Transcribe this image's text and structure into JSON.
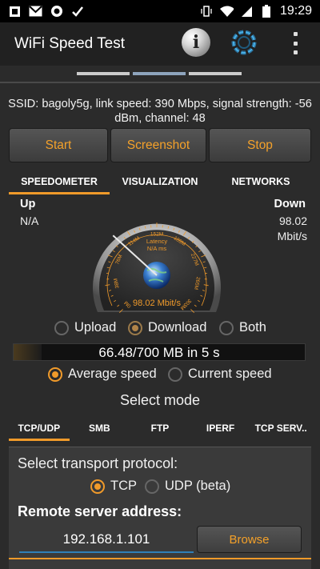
{
  "status_bar": {
    "time": "19:29",
    "icons_left": [
      "notification-app-icon",
      "gmail-icon",
      "circle-icon",
      "check-icon"
    ],
    "icons_right": [
      "vibrate-icon",
      "wifi-icon",
      "signal-icon",
      "battery-icon"
    ]
  },
  "app_bar": {
    "title": "WiFi Speed Test",
    "info_glyph": "i"
  },
  "ssid_text": "SSID: bagoly5g, link speed: 390 Mbps, signal strength: -56 dBm, channel: 48",
  "buttons": {
    "start": "Start",
    "screenshot": "Screenshot",
    "stop": "Stop"
  },
  "tabs": [
    "SPEEDOMETER",
    "VISUALIZATION",
    "NETWORKS"
  ],
  "active_tab": 0,
  "up": {
    "label": "Up",
    "value": "N/A"
  },
  "down": {
    "label": "Down",
    "value": "98.02",
    "unit": "Mbit/s"
  },
  "gauge": {
    "scale_labels": [
      "0M",
      "38M",
      "76M",
      "114M",
      "152M",
      "189M",
      "227M",
      "265M",
      "303M"
    ],
    "latency_label": "Latency",
    "latency_value": "N/A ms",
    "reading": "98.02 Mbit/s",
    "needle_value": 98.02,
    "max": 303
  },
  "direction": {
    "options": [
      "Upload",
      "Download",
      "Both"
    ],
    "selected": "Download"
  },
  "progress": {
    "text": "66.48/700 MB in 5 s",
    "fraction": 0.095
  },
  "speed_mode": {
    "options": [
      "Average speed",
      "Current speed"
    ],
    "selected": "Average speed"
  },
  "select_mode_title": "Select mode",
  "mode_tabs": [
    "TCP/UDP",
    "SMB",
    "FTP",
    "IPERF",
    "TCP SERV.."
  ],
  "active_mode_tab": 0,
  "transport": {
    "label": "Select transport protocol:",
    "options": [
      "TCP",
      "UDP (beta)"
    ],
    "selected": "TCP"
  },
  "remote": {
    "label": "Remote server address:",
    "value": "192.168.1.101",
    "browse": "Browse"
  },
  "colors": {
    "accent": "#f09a2a",
    "button_text": "#f4a12a",
    "background": "#2b2b2b"
  }
}
